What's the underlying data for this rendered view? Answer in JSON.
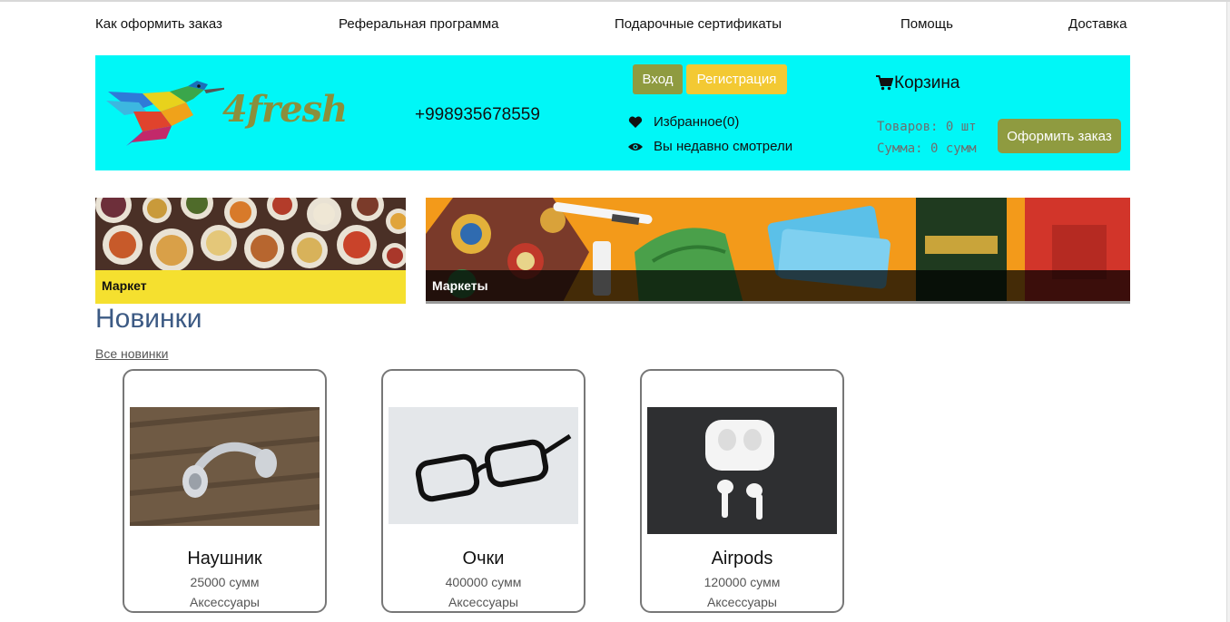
{
  "top_nav": [
    {
      "label": "Как оформить заказ"
    },
    {
      "label": "Реферальная программа"
    },
    {
      "label": "Подарочные сертификаты"
    },
    {
      "label": "Помощь"
    },
    {
      "label": "Доставка"
    }
  ],
  "header": {
    "logo_text": "4fresh",
    "phone": "+998935678559",
    "login_label": "Вход",
    "register_label": "Регистрация",
    "favorites_label": "Избранное(0)",
    "recent_label": "Вы недавно смотрели",
    "cart_title": "Корзина",
    "cart_items": "Товаров: 0 шт",
    "cart_sum": "Сумма: 0 сумм",
    "order_label": "Оформить заказ"
  },
  "banners": [
    {
      "caption": "Маркет"
    },
    {
      "caption": "Маркеты"
    }
  ],
  "section": {
    "title": "Новинки",
    "link": "Все новинки"
  },
  "products": [
    {
      "name": "Наушник",
      "price": "25000 сумм",
      "category": "Аксессуары"
    },
    {
      "name": "Очки",
      "price": "400000 сумм",
      "category": "Аксессуары"
    },
    {
      "name": "Airpods",
      "price": "120000 сумм",
      "category": "Аксессуары"
    }
  ],
  "colors": {
    "header_bg": "#00f7f7",
    "olive_button": "#8f9b40",
    "yellow_button": "#f3c933",
    "title_blue": "#3c5a84"
  }
}
